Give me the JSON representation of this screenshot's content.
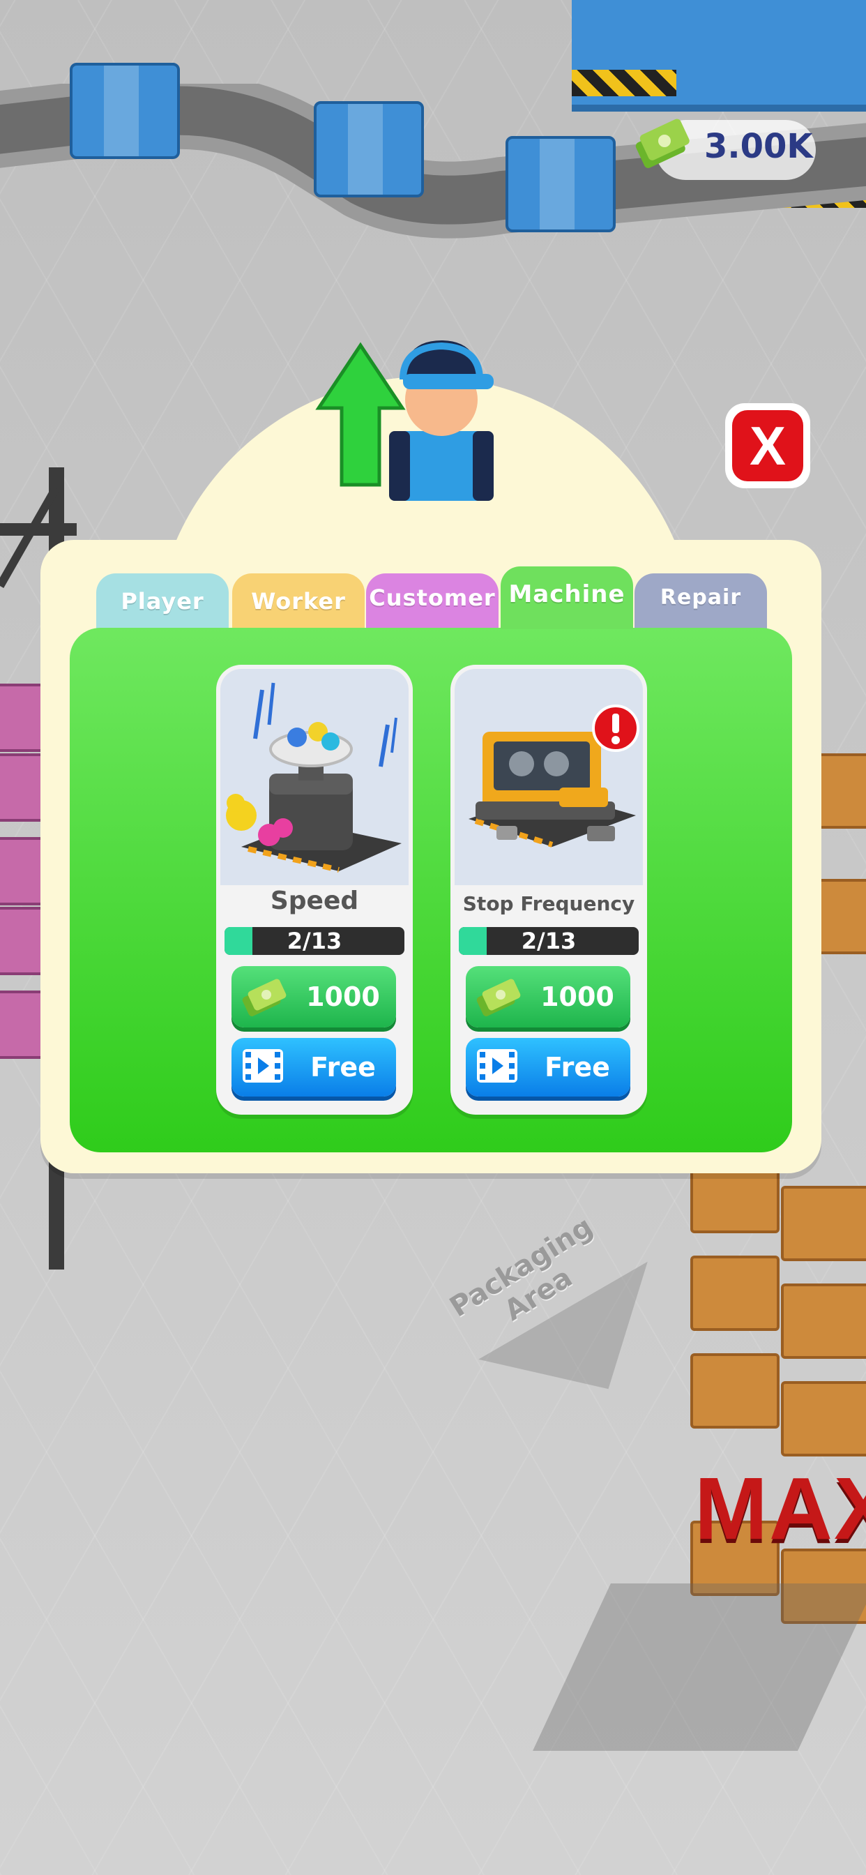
{
  "hud": {
    "money": "3.00K"
  },
  "world": {
    "floor_label": "Packaging Area",
    "max_sign": "MAX"
  },
  "popup": {
    "close_glyph": "X",
    "tabs": [
      {
        "label": "Player",
        "color": "#a6e0e3"
      },
      {
        "label": "Worker",
        "color": "#f8d274"
      },
      {
        "label": "Customer",
        "color": "#db84e1"
      },
      {
        "label": "Machine",
        "color": "#6fe05d",
        "active": true
      },
      {
        "label": "Repair Man",
        "color": "#9ea8c7"
      }
    ],
    "cards": [
      {
        "title": "Speed",
        "level": "2/13",
        "level_fraction": 0.154,
        "price": "1000",
        "free_label": "Free",
        "icon": "duck-machine-icon"
      },
      {
        "title": "Stop Frequency",
        "level": "2/13",
        "level_fraction": 0.154,
        "price": "1000",
        "free_label": "Free",
        "icon": "broken-machine-alert-icon"
      }
    ]
  },
  "colors": {
    "panel_green": "#4cd93a",
    "popup_cream": "#fdf8d6",
    "buy_green": "#1eb54c",
    "free_blue": "#0a7ee8",
    "close_red": "#e0121a"
  }
}
